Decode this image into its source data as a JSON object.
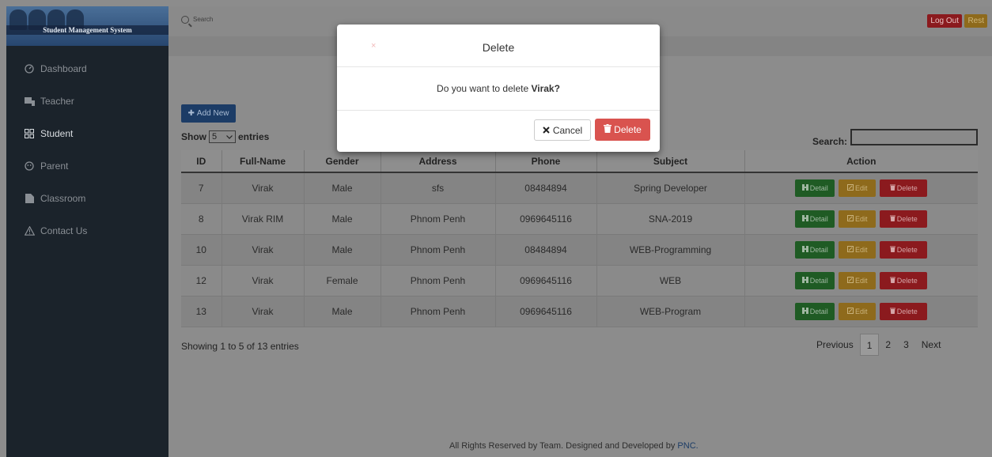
{
  "app": {
    "logo_text": "Student Management System"
  },
  "sidebar": {
    "items": [
      {
        "label": "Dashboard",
        "icon": "dashboard-icon"
      },
      {
        "label": "Teacher",
        "icon": "teacher-icon"
      },
      {
        "label": "Student",
        "icon": "student-icon"
      },
      {
        "label": "Parent",
        "icon": "parent-icon"
      },
      {
        "label": "Classroom",
        "icon": "classroom-icon"
      },
      {
        "label": "Contact Us",
        "icon": "warning-icon"
      }
    ],
    "active": "Student"
  },
  "topbar": {
    "search_placeholder": "Search",
    "logout_label": "Log Out",
    "rest_label": "Rest"
  },
  "toolbar": {
    "add_label": "Add New",
    "show_label": "Show",
    "show_value": "5",
    "entries_label": "entries",
    "search_label": "Search:"
  },
  "table": {
    "columns": [
      "ID",
      "Full-Name",
      "Gender",
      "Address",
      "Phone",
      "Subject",
      "Action"
    ],
    "rows": [
      [
        "7",
        "Virak",
        "Male",
        "sfs",
        "08484894",
        "Spring Developer"
      ],
      [
        "8",
        "Virak RIM",
        "Male",
        "Phnom Penh",
        "0969645116",
        "SNA-2019"
      ],
      [
        "10",
        "Virak",
        "Male",
        "Phnom Penh",
        "08484894",
        "WEB-Programming"
      ],
      [
        "12",
        "Virak",
        "Female",
        "Phnom Penh",
        "0969645116",
        "WEB"
      ],
      [
        "13",
        "Virak",
        "Male",
        "Phnom Penh",
        "0969645116",
        "WEB-Program"
      ]
    ],
    "actions": {
      "detail": "Detail",
      "edit": "Edit",
      "delete": "Delete"
    }
  },
  "pagination": {
    "info": "Showing 1 to 5 of 13 entries",
    "previous": "Previous",
    "pages": [
      "1",
      "2",
      "3"
    ],
    "current": "1",
    "next": "Next"
  },
  "footer": {
    "text": "All Rights Reserved by Team. Designed and Developed by",
    "link": "PNC."
  },
  "modal": {
    "title": "Delete",
    "close": "×",
    "message_prefix": "Do you want to delete",
    "name": "Virak?",
    "cancel_label": "Cancel",
    "delete_label": "Delete"
  },
  "colors": {
    "danger": "#d9534f",
    "success": "#1f5b24",
    "warning": "#8e6a1c",
    "primary": "#1c3c66"
  }
}
